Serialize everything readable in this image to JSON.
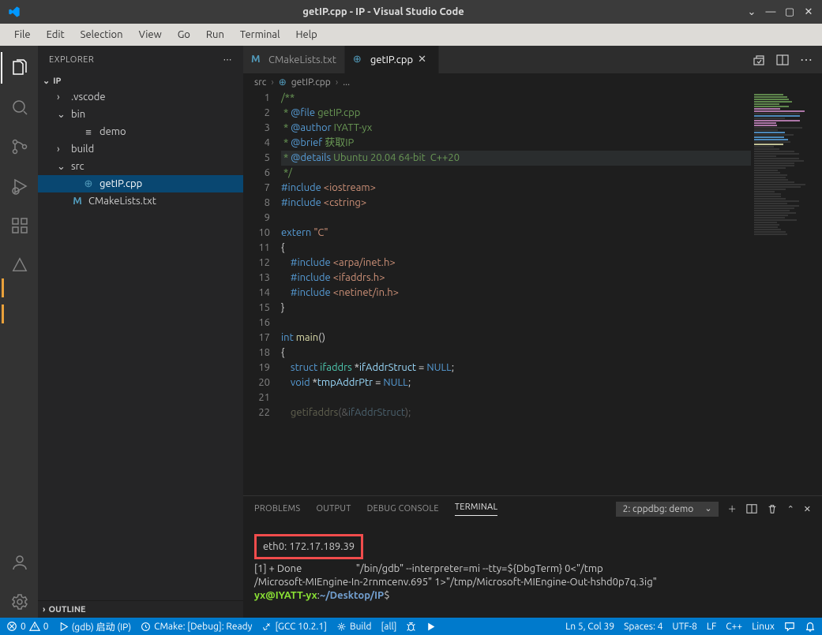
{
  "window": {
    "title": "getIP.cpp - IP - Visual Studio Code"
  },
  "menu": {
    "items": [
      "File",
      "Edit",
      "Selection",
      "View",
      "Go",
      "Run",
      "Terminal",
      "Help"
    ]
  },
  "sidebar": {
    "title": "EXPLORER",
    "root": "IP",
    "items": [
      {
        "label": ".vscode",
        "indent": 1,
        "chev": "›",
        "type": "folder"
      },
      {
        "label": "bin",
        "indent": 1,
        "chev": "⌄",
        "type": "folder"
      },
      {
        "label": "demo",
        "indent": 2,
        "chev": "",
        "type": "file-bin"
      },
      {
        "label": "build",
        "indent": 1,
        "chev": "›",
        "type": "folder"
      },
      {
        "label": "src",
        "indent": 1,
        "chev": "⌄",
        "type": "folder"
      },
      {
        "label": "getIP.cpp",
        "indent": 2,
        "chev": "",
        "type": "file-cpp",
        "selected": true
      },
      {
        "label": "CMakeLists.txt",
        "indent": 1,
        "chev": "",
        "type": "file-cmake"
      }
    ],
    "outline": "OUTLINE"
  },
  "tabs": {
    "items": [
      {
        "label": "CMakeLists.txt",
        "type": "cmake",
        "active": false,
        "close": false
      },
      {
        "label": "getIP.cpp",
        "type": "cpp",
        "active": true,
        "close": true
      }
    ]
  },
  "breadcrumb": {
    "parts": [
      "src",
      "getIP.cpp",
      "..."
    ]
  },
  "code": {
    "lines": [
      {
        "n": 1,
        "html": "<span class='c-com'>/**</span>"
      },
      {
        "n": 2,
        "html": "<span class='c-com'> * </span><span class='c-doc'>@file</span><span class='c-com'> getIP.cpp</span>"
      },
      {
        "n": 3,
        "html": "<span class='c-com'> * </span><span class='c-doc'>@author</span><span class='c-com'> IYATT-yx</span>"
      },
      {
        "n": 4,
        "html": "<span class='c-com'> * </span><span class='c-doc'>@brief</span><span class='c-com'> 获取IP</span>"
      },
      {
        "n": 5,
        "html": "<span class='c-com'> * </span><span class='c-doc'>@details</span><span class='c-com'> Ubuntu 20.04 64-bit  C++20</span>",
        "hl": true
      },
      {
        "n": 6,
        "html": "<span class='c-com'> */</span>"
      },
      {
        "n": 7,
        "html": "<span class='c-doc'>#include</span> <span class='c-str'>&lt;iostream&gt;</span>"
      },
      {
        "n": 8,
        "html": "<span class='c-doc'>#include</span> <span class='c-str'>&lt;cstring&gt;</span>"
      },
      {
        "n": 9,
        "html": ""
      },
      {
        "n": 10,
        "html": "<span class='c-key'>extern</span> <span class='c-str'>\"C\"</span>"
      },
      {
        "n": 11,
        "html": "{"
      },
      {
        "n": 12,
        "html": "    <span class='c-doc'>#include</span> <span class='c-str'>&lt;arpa/inet.h&gt;</span>"
      },
      {
        "n": 13,
        "html": "    <span class='c-doc'>#include</span> <span class='c-str'>&lt;ifaddrs.h&gt;</span>"
      },
      {
        "n": 14,
        "html": "    <span class='c-doc'>#include</span> <span class='c-str'>&lt;netinet/in.h&gt;</span>"
      },
      {
        "n": 15,
        "html": "}"
      },
      {
        "n": 16,
        "html": ""
      },
      {
        "n": 17,
        "html": "<span class='c-key'>int</span> <span class='c-fn'>main</span>()"
      },
      {
        "n": 18,
        "html": "{"
      },
      {
        "n": 19,
        "html": "    <span class='c-key'>struct</span> <span class='c-type'>ifaddrs</span> *<span class='c-id'>ifAddrStruct</span> = <span class='c-null'>NULL</span>;"
      },
      {
        "n": 20,
        "html": "    <span class='c-key'>void</span> *<span class='c-id'>tmpAddrPtr</span> = <span class='c-null'>NULL</span>;"
      },
      {
        "n": 21,
        "html": ""
      },
      {
        "n": 22,
        "html": "    <span class='c-fn' style='opacity:.35'>getifaddrs</span><span style='opacity:.35'>(&amp;</span><span class='c-id' style='opacity:.35'>ifAddrStruct</span><span style='opacity:.35'>);</span>"
      }
    ]
  },
  "panel": {
    "tabs": [
      "PROBLEMS",
      "OUTPUT",
      "DEBUG CONSOLE",
      "TERMINAL"
    ],
    "active": "TERMINAL",
    "select": "2: cppdbg: demo",
    "terminal": {
      "highlight": "eth0: 172.17.189.39",
      "line1": "[1] + Done                       \"/bin/gdb\" --interpreter=mi --tty=${DbgTerm} 0<\"/tmp",
      "line2": "/Microsoft-MIEngine-In-2rnmcenv.695\" 1>\"/tmp/Microsoft-MIEngine-Out-hshd0p7q.3ig\"",
      "prompt_user": "yx@IYATT-yx",
      "prompt_sep": ":",
      "prompt_path": "~/Desktop/IP",
      "prompt_end": "$"
    }
  },
  "status": {
    "errors": "0",
    "warnings": "0",
    "launch": "(gdb) 启动 (IP)",
    "cmake": "CMake: [Debug]: Ready",
    "kit": "[GCC 10.2.1]",
    "build": "Build",
    "target": "[all]",
    "pos": "Ln 5, Col 39",
    "spaces": "Spaces: 4",
    "enc": "UTF-8",
    "eol": "LF",
    "lang": "C++",
    "os": "Linux"
  }
}
